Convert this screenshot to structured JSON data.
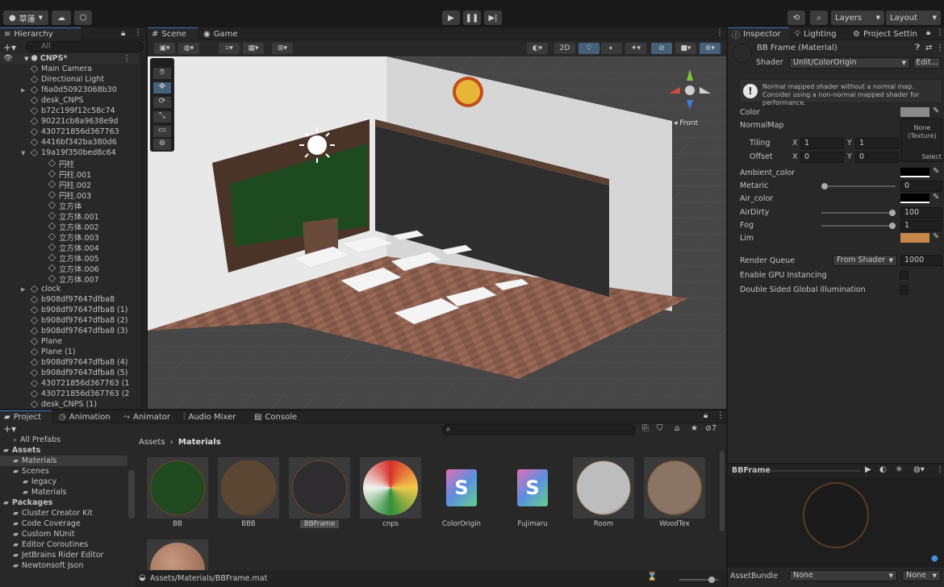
{
  "topbar": {
    "account_label": "草蓮",
    "layers_label": "Layers",
    "layout_label": "Layout"
  },
  "hierarchy": {
    "tab": "Hierarchy",
    "search_placeholder": "All",
    "scene_name": "CNPS*",
    "items": [
      {
        "label": "Main Camera",
        "indent": 1
      },
      {
        "label": "Directional Light",
        "indent": 1
      },
      {
        "label": "f6a0d50923068b30",
        "indent": 1,
        "arrow": true
      },
      {
        "label": "desk_CNPS",
        "indent": 1
      },
      {
        "label": "b72c199f12c58c74",
        "indent": 1
      },
      {
        "label": "90221cb8a9638e9d",
        "indent": 1
      },
      {
        "label": "430721856d367763",
        "indent": 1
      },
      {
        "label": "4416bf342ba380d6",
        "indent": 1
      },
      {
        "label": "19a19f350bed8c64",
        "indent": 1,
        "arrow": true,
        "open": true
      },
      {
        "label": "円柱",
        "indent": 2
      },
      {
        "label": "円柱.001",
        "indent": 2
      },
      {
        "label": "円柱.002",
        "indent": 2
      },
      {
        "label": "円柱.003",
        "indent": 2
      },
      {
        "label": "立方体",
        "indent": 2
      },
      {
        "label": "立方体.001",
        "indent": 2
      },
      {
        "label": "立方体.002",
        "indent": 2
      },
      {
        "label": "立方体.003",
        "indent": 2
      },
      {
        "label": "立方体.004",
        "indent": 2
      },
      {
        "label": "立方体.005",
        "indent": 2
      },
      {
        "label": "立方体.006",
        "indent": 2
      },
      {
        "label": "立方体.007",
        "indent": 2
      },
      {
        "label": "clock",
        "indent": 1,
        "arrow": true
      },
      {
        "label": "b908df97647dfba8",
        "indent": 1
      },
      {
        "label": "b908df97647dfba8 (1)",
        "indent": 1
      },
      {
        "label": "b908df97647dfba8 (2)",
        "indent": 1
      },
      {
        "label": "b908df97647dfba8 (3)",
        "indent": 1
      },
      {
        "label": "Plane",
        "indent": 1
      },
      {
        "label": "Plane (1)",
        "indent": 1
      },
      {
        "label": "b908df97647dfba8 (4)",
        "indent": 1
      },
      {
        "label": "b908df97647dfba8 (5)",
        "indent": 1
      },
      {
        "label": "430721856d367763 (1",
        "indent": 1
      },
      {
        "label": "430721856d367763 (2",
        "indent": 1
      },
      {
        "label": "desk_CNPS (1)",
        "indent": 1
      }
    ]
  },
  "scene": {
    "tab_scene": "Scene",
    "tab_game": "Game",
    "btn_2d": "2D",
    "gizmo_label": "Front"
  },
  "inspector": {
    "tab_inspector": "Inspector",
    "tab_lighting": "Lighting",
    "tab_project_settings": "Project Settin",
    "material_name": "BB Frame (Material)",
    "shader_label": "Shader",
    "shader_value": "Unlit/ColorOrigin",
    "edit_label": "Edit...",
    "warning": "Normal mapped shader without a normal map. Consider using a non-normal mapped shader for performance.",
    "color_label": "Color",
    "normalmap_label": "NormalMap",
    "texture_none": "None (Texture)",
    "select_label": "Select",
    "tiling_label": "Tiling",
    "offset_label": "Offset",
    "tiling_x": "1",
    "tiling_y": "1",
    "offset_x": "0",
    "offset_y": "0",
    "x_label": "X",
    "y_label": "Y",
    "ambient_label": "Ambient_color",
    "metaric_label": "Metaric",
    "metaric_value": "0",
    "metaric_level": 0,
    "air_color_label": "Air_color",
    "airdirty_label": "AirDirty",
    "airdirty_value": "100",
    "airdirty_level": 1,
    "fog_label": "Fog",
    "fog_value": "1",
    "fog_level": 1,
    "lim_label": "Lim",
    "lim_color": "#c8884a",
    "render_queue_label": "Render Queue",
    "render_queue_mode": "From Shader",
    "render_queue_value": "1000",
    "gpu_label": "Enable GPU Instancing",
    "double_sided_label": "Double Sided Global Illumination",
    "preview_name": "BBFrame",
    "assetbundle_label": "AssetBundle",
    "assetbundle_value": "None",
    "assetbundle_variant": "None"
  },
  "project": {
    "tabs": [
      "Project",
      "Animation",
      "Animator",
      "Audio Mixer",
      "Console"
    ],
    "hidden_count": "7",
    "tree": [
      {
        "label": "All Prefabs",
        "indent": 1
      },
      {
        "label": "Assets",
        "indent": 0,
        "bold": true
      },
      {
        "label": "Materials",
        "indent": 1,
        "selected": true
      },
      {
        "label": "Scenes",
        "indent": 1
      },
      {
        "label": "legacy",
        "indent": 2
      },
      {
        "label": "Materials",
        "indent": 2
      },
      {
        "label": "Packages",
        "indent": 0,
        "bold": true
      },
      {
        "label": "Cluster Creator Kit",
        "indent": 1
      },
      {
        "label": "Code Coverage",
        "indent": 1
      },
      {
        "label": "Custom NUnit",
        "indent": 1
      },
      {
        "label": "Editor Coroutines",
        "indent": 1
      },
      {
        "label": "JetBrains Rider Editor",
        "indent": 1
      },
      {
        "label": "Newtonsoft Json",
        "indent": 1
      }
    ],
    "breadcrumb_root": "Assets",
    "breadcrumb_leaf": "Materials",
    "assets": [
      {
        "name": "BB",
        "kind": "ball",
        "color": "#1f4a1f"
      },
      {
        "name": "BBB",
        "kind": "ball",
        "color": "#5a4632"
      },
      {
        "name": "BBFrame",
        "kind": "ball",
        "color": "#2e2c2f",
        "selected": true
      },
      {
        "name": "cnps",
        "kind": "logo"
      },
      {
        "name": "ColorOrigin",
        "kind": "shader"
      },
      {
        "name": "Fujimaru",
        "kind": "shader"
      },
      {
        "name": "Room",
        "kind": "ball",
        "color": "#bdbdbd"
      },
      {
        "name": "WoodTex",
        "kind": "ball",
        "color": "#8a7564"
      }
    ],
    "footer_path": "Assets/Materials/BBFrame.mat"
  }
}
